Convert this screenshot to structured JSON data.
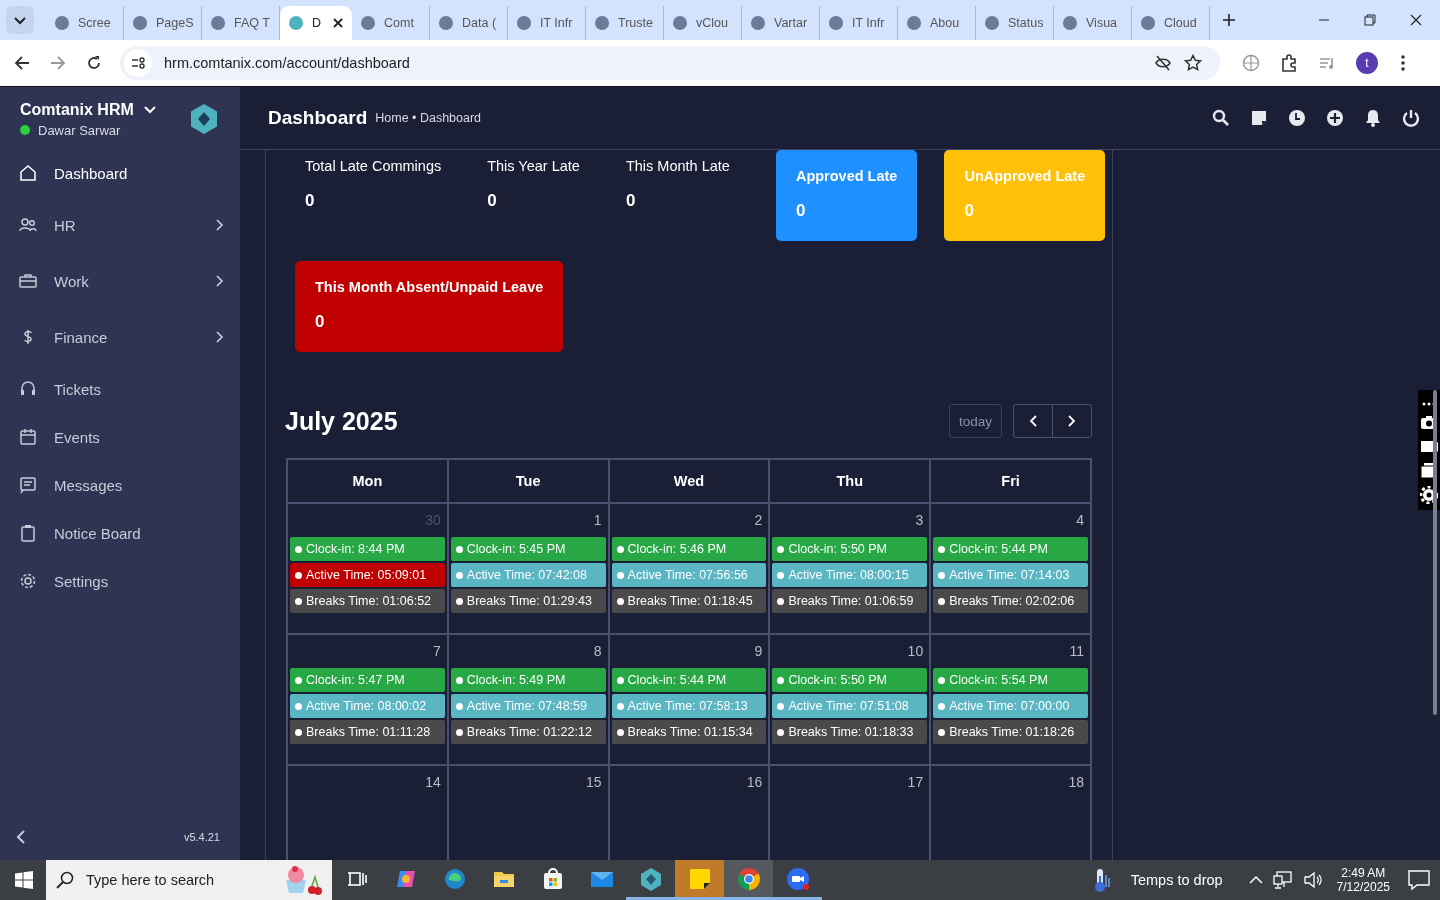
{
  "browser": {
    "tabs": [
      {
        "title": "Scree",
        "selected": false
      },
      {
        "title": "PageS",
        "selected": false
      },
      {
        "title": "FAQ T",
        "selected": false
      },
      {
        "title": "D",
        "selected": true
      },
      {
        "title": "Comt",
        "selected": false
      },
      {
        "title": "Data (",
        "selected": false
      },
      {
        "title": "IT Infr",
        "selected": false
      },
      {
        "title": "Truste",
        "selected": false
      },
      {
        "title": "vClou",
        "selected": false
      },
      {
        "title": "Vartar",
        "selected": false
      },
      {
        "title": "IT Infr",
        "selected": false
      },
      {
        "title": "Abou",
        "selected": false
      },
      {
        "title": "Status",
        "selected": false
      },
      {
        "title": "Visua",
        "selected": false
      },
      {
        "title": "Cloud",
        "selected": false
      }
    ],
    "url": "hrm.comtanix.com/account/dashboard",
    "profile_initial": "t"
  },
  "sidebar": {
    "brand": "Comtanix HRM",
    "user": {
      "name": "Dawar Sarwar",
      "online": true
    },
    "items": [
      {
        "label": "Dashboard",
        "kind": "home",
        "selected": true,
        "has_children": false
      },
      {
        "label": "HR",
        "kind": "users",
        "selected": false,
        "has_children": true
      },
      {
        "label": "Work",
        "kind": "briefcase",
        "selected": false,
        "has_children": true
      },
      {
        "label": "Finance",
        "kind": "dollar",
        "selected": false,
        "has_children": true
      },
      {
        "label": "Tickets",
        "kind": "headset",
        "selected": false,
        "has_children": false
      },
      {
        "label": "Events",
        "kind": "calendar",
        "selected": false,
        "has_children": false
      },
      {
        "label": "Messages",
        "kind": "message",
        "selected": false,
        "has_children": false
      },
      {
        "label": "Notice Board",
        "kind": "clipboard",
        "selected": false,
        "has_children": false
      },
      {
        "label": "Settings",
        "kind": "gear",
        "selected": false,
        "has_children": false
      }
    ],
    "version": "v5.4.21"
  },
  "header": {
    "title": "Dashboard",
    "breadcrumb": "Home • Dashboard"
  },
  "late_stats": [
    {
      "kind": "plain",
      "label": "Total Late Commings",
      "value": "0"
    },
    {
      "kind": "plain",
      "label": "This Year Late",
      "value": "0"
    },
    {
      "kind": "plain",
      "label": "This Month Late",
      "value": "0"
    },
    {
      "kind": "card",
      "label": "Approved Late",
      "value": "0",
      "color": "#1e90ff"
    },
    {
      "kind": "card",
      "label": "UnApproved Late",
      "value": "0",
      "color": "#ffc107"
    }
  ],
  "leave_stats": [
    {
      "kind": "card",
      "label": "This Month Absent/Unpaid Leave",
      "value": "0",
      "color": "#c00000"
    }
  ],
  "calendar": {
    "title": "July 2025",
    "today_button": "today",
    "weekdays": [
      "Mon",
      "Tue",
      "Wed",
      "Thu",
      "Fri"
    ],
    "weeks": [
      {
        "days": [
          {
            "number": "30",
            "other_month": true,
            "events": [
              {
                "text": "Clock-in: 8:44 PM",
                "color": "#28a745"
              },
              {
                "text": "Active Time: 05:09:01",
                "color": "#c00000"
              },
              {
                "text": "Breaks Time: 01:06:52",
                "color": "#4a4a4a"
              }
            ]
          },
          {
            "number": "1",
            "other_month": false,
            "events": [
              {
                "text": "Clock-in: 5:45 PM",
                "color": "#28a745"
              },
              {
                "text": "Active Time: 07:42:08",
                "color": "#5bb6c4"
              },
              {
                "text": "Breaks Time: 01:29:43",
                "color": "#4a4a4a"
              }
            ]
          },
          {
            "number": "2",
            "other_month": false,
            "events": [
              {
                "text": "Clock-in: 5:46 PM",
                "color": "#28a745"
              },
              {
                "text": "Active Time: 07:56:56",
                "color": "#5bb6c4"
              },
              {
                "text": "Breaks Time: 01:18:45",
                "color": "#4a4a4a"
              }
            ]
          },
          {
            "number": "3",
            "other_month": false,
            "events": [
              {
                "text": "Clock-in: 5:50 PM",
                "color": "#28a745"
              },
              {
                "text": "Active Time: 08:00:15",
                "color": "#5bb6c4"
              },
              {
                "text": "Breaks Time: 01:06:59",
                "color": "#4a4a4a"
              }
            ]
          },
          {
            "number": "4",
            "other_month": false,
            "events": [
              {
                "text": "Clock-in: 5:44 PM",
                "color": "#28a745"
              },
              {
                "text": "Active Time: 07:14:03",
                "color": "#5bb6c4"
              },
              {
                "text": "Breaks Time: 02:02:06",
                "color": "#4a4a4a"
              }
            ]
          }
        ]
      },
      {
        "days": [
          {
            "number": "7",
            "other_month": false,
            "events": [
              {
                "text": "Clock-in: 5:47 PM",
                "color": "#28a745"
              },
              {
                "text": "Active Time: 08:00:02",
                "color": "#5bb6c4"
              },
              {
                "text": "Breaks Time: 01:11:28",
                "color": "#4a4a4a"
              }
            ]
          },
          {
            "number": "8",
            "other_month": false,
            "events": [
              {
                "text": "Clock-in: 5:49 PM",
                "color": "#28a745"
              },
              {
                "text": "Active Time: 07:48:59",
                "color": "#5bb6c4"
              },
              {
                "text": "Breaks Time: 01:22:12",
                "color": "#4a4a4a"
              }
            ]
          },
          {
            "number": "9",
            "other_month": false,
            "events": [
              {
                "text": "Clock-in: 5:44 PM",
                "color": "#28a745"
              },
              {
                "text": "Active Time: 07:58:13",
                "color": "#5bb6c4"
              },
              {
                "text": "Breaks Time: 01:15:34",
                "color": "#4a4a4a"
              }
            ]
          },
          {
            "number": "10",
            "other_month": false,
            "events": [
              {
                "text": "Clock-in: 5:50 PM",
                "color": "#28a745"
              },
              {
                "text": "Active Time: 07:51:08",
                "color": "#5bb6c4"
              },
              {
                "text": "Breaks Time: 01:18:33",
                "color": "#4a4a4a"
              }
            ]
          },
          {
            "number": "11",
            "other_month": false,
            "events": [
              {
                "text": "Clock-in: 5:54 PM",
                "color": "#28a745"
              },
              {
                "text": "Active Time: 07:00:00",
                "color": "#5bb6c4"
              },
              {
                "text": "Breaks Time: 01:18:26",
                "color": "#4a4a4a"
              }
            ]
          }
        ]
      },
      {
        "days": [
          {
            "number": "14",
            "other_month": false
          },
          {
            "number": "15",
            "other_month": false
          },
          {
            "number": "16",
            "other_month": false
          },
          {
            "number": "17",
            "other_month": false
          },
          {
            "number": "18",
            "other_month": false
          }
        ]
      }
    ]
  },
  "taskbar": {
    "search_placeholder": "Type here to search",
    "apps": [
      {
        "kind": "taskview",
        "running": false,
        "active": false
      },
      {
        "kind": "copilot",
        "running": false,
        "active": false
      },
      {
        "kind": "edge",
        "running": false,
        "active": false
      },
      {
        "kind": "folder",
        "running": false,
        "active": false
      },
      {
        "kind": "store",
        "running": false,
        "active": false
      },
      {
        "kind": "mail",
        "running": false,
        "active": false
      },
      {
        "kind": "hexapp",
        "running": true,
        "active": false
      },
      {
        "kind": "notes",
        "running": true,
        "active": true
      },
      {
        "kind": "chrome",
        "running": true,
        "active": true
      },
      {
        "kind": "zoom",
        "running": true,
        "active": false
      }
    ],
    "weather": "Temps to drop",
    "time": "2:49 AM",
    "date": "7/12/2025"
  }
}
